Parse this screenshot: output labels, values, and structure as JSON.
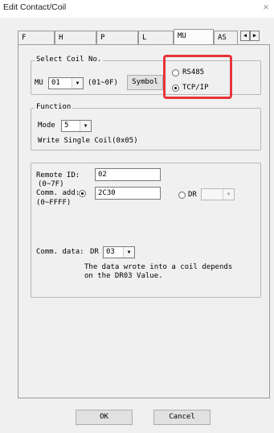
{
  "window": {
    "title": "Edit Contact/Coil",
    "close_glyph": "×"
  },
  "tabs": [
    "F",
    "H",
    "P",
    "L",
    "MU",
    "AS"
  ],
  "active_tab": "MU",
  "tab_scroll": {
    "left": "◀",
    "right": "▶"
  },
  "select_coil": {
    "legend": "Select Coil No.",
    "prefix": "MU",
    "coil_value": "01",
    "range": "(01~0F)",
    "symbol_button": "Symbol",
    "protocol_options": [
      "RS485",
      "TCP/IP"
    ],
    "protocol_selected": "TCP/IP"
  },
  "function": {
    "legend": "Function",
    "mode_label": "Mode",
    "mode_value": "5",
    "description": "Write Single Coil(0x05)"
  },
  "params": {
    "remote_id_label": "Remote ID:",
    "remote_id_range": "(0~7F)",
    "remote_id_value": "02",
    "comm_add_label": "Comm. add:",
    "comm_add_range": "(0~FFFF)",
    "comm_add_value": "2C30",
    "dr_label": "DR",
    "dr_value": "",
    "comm_data_label": "Comm. data:",
    "comm_data_prefix": "DR",
    "comm_data_value": "03",
    "note_line1": "The data wrote into a coil depends",
    "note_line2": "on the DR03 Value."
  },
  "buttons": {
    "ok": "OK",
    "cancel": "Cancel"
  },
  "colors": {
    "highlight": "#e8343a",
    "dialog_bg": "#f0f0f0"
  },
  "icons": {
    "dropdown": "▼",
    "close": "close-icon"
  }
}
